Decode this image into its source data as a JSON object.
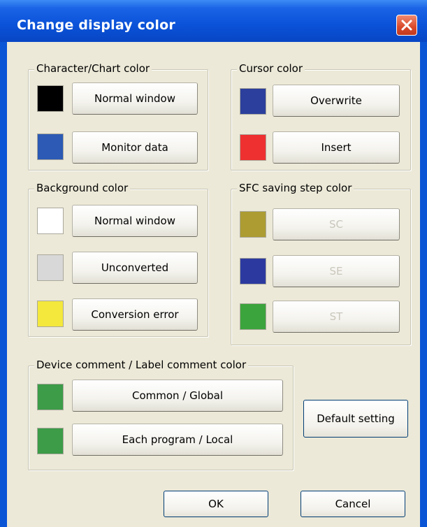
{
  "window": {
    "title": "Change display color"
  },
  "colors": {
    "black": "#000000",
    "blue": "#2c5ab4",
    "navy": "#2c3f9c",
    "red": "#ee3030",
    "white": "#ffffff",
    "lightgray": "#d8d8d8",
    "yellow": "#f4e83c",
    "olive": "#ac9c32",
    "navy2": "#2c3aa0",
    "green": "#3ca43c",
    "green2": "#3c9c48"
  },
  "char_chart": {
    "legend": "Character/Chart color",
    "items": [
      {
        "label": "Normal window",
        "color": "#000000"
      },
      {
        "label": "Monitor data",
        "color": "#2c5ab4"
      }
    ]
  },
  "cursor": {
    "legend": "Cursor color",
    "items": [
      {
        "label": "Overwrite",
        "color": "#2c3f9c"
      },
      {
        "label": "Insert",
        "color": "#ee3030"
      }
    ]
  },
  "background": {
    "legend": "Background color",
    "items": [
      {
        "label": "Normal window",
        "color": "#ffffff"
      },
      {
        "label": "Unconverted",
        "color": "#d8d8d8"
      },
      {
        "label": "Conversion error",
        "color": "#f4e83c"
      }
    ]
  },
  "sfc": {
    "legend": "SFC saving step color",
    "items": [
      {
        "label": "SC",
        "color": "#ac9c32"
      },
      {
        "label": "SE",
        "color": "#2c3aa0"
      },
      {
        "label": "ST",
        "color": "#3ca43c"
      }
    ]
  },
  "device_comment": {
    "legend": "Device comment / Label comment color",
    "items": [
      {
        "label": "Common / Global",
        "color": "#3c9c48"
      },
      {
        "label": "Each program / Local",
        "color": "#3c9c48"
      }
    ]
  },
  "buttons": {
    "default": "Default setting",
    "ok": "OK",
    "cancel": "Cancel"
  }
}
